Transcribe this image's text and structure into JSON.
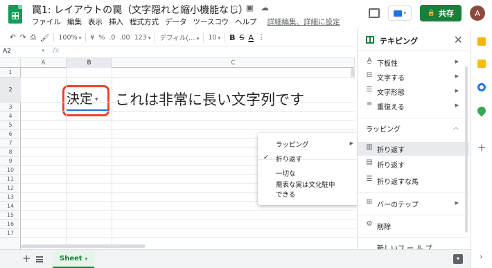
{
  "header": {
    "title": "罠1: レイアウトの罠（文字隠れと縮小機能なし）",
    "menu": [
      "ファイル",
      "編集",
      "表示",
      "挿入",
      "程式方式",
      "データ",
      "ツースコウ",
      "ヘルプ"
    ],
    "edit_link": "詳細編集、詳細に設定",
    "share_label": "共存",
    "avatar_letter": "A"
  },
  "toolbar": {
    "zoom": "100%",
    "currency": "¥",
    "percent": "%",
    "dec_less": ".0",
    "dec_more": ".00",
    "num_format": "123",
    "font": "デフィル(…",
    "font_size": "10",
    "bold": "B",
    "strike": "S",
    "color_a": "A"
  },
  "formula_bar": {
    "cell_ref": "A2",
    "fx": "fx"
  },
  "grid": {
    "columns": [
      "A",
      "B",
      "C"
    ],
    "rows": [
      "1",
      "2",
      "3",
      "4",
      "5",
      "6",
      "7",
      "8",
      "9",
      "10",
      "11",
      "12",
      "13",
      "14",
      "15",
      "16",
      "17"
    ],
    "chip_value": "決定",
    "long_text": "これは非常に長い文字列です"
  },
  "context_menu": {
    "items": [
      {
        "label": "ラッピング",
        "submenu": true
      },
      {
        "label": "折り返す",
        "checked": true
      },
      {
        "label": "一切な"
      },
      {
        "label": "需表な実は文化駐中"
      },
      {
        "label": "できる"
      }
    ]
  },
  "panel": {
    "title": "テキピング",
    "items": [
      {
        "icon": "A̲",
        "label": "下板性",
        "submenu": true
      },
      {
        "icon": "⊟",
        "label": "文字する",
        "submenu": true
      },
      {
        "icon": "☰",
        "label": "文字形態",
        "submenu": true
      },
      {
        "icon": "≡",
        "label": "重復える",
        "submenu": true
      }
    ],
    "section": "ラッピング",
    "wrap_items": [
      {
        "icon": "▥",
        "label": "折り返す",
        "active": true
      },
      {
        "icon": "▤",
        "label": "折り返す"
      },
      {
        "icon": "☰",
        "label": "折り返すな馬"
      }
    ],
    "extra_items": [
      {
        "icon": "⊞",
        "label": "バーのテップ",
        "submenu": true
      },
      {
        "icon": "⚙",
        "label": "削除"
      },
      {
        "icon": "",
        "label": "新しいフ ー ル プ"
      }
    ]
  },
  "bottom": {
    "sheet_name": "Sheet"
  },
  "colors": {
    "brand_green": "#188038",
    "chip_outline": "#e8412f",
    "selection_blue": "#1a73e8"
  }
}
